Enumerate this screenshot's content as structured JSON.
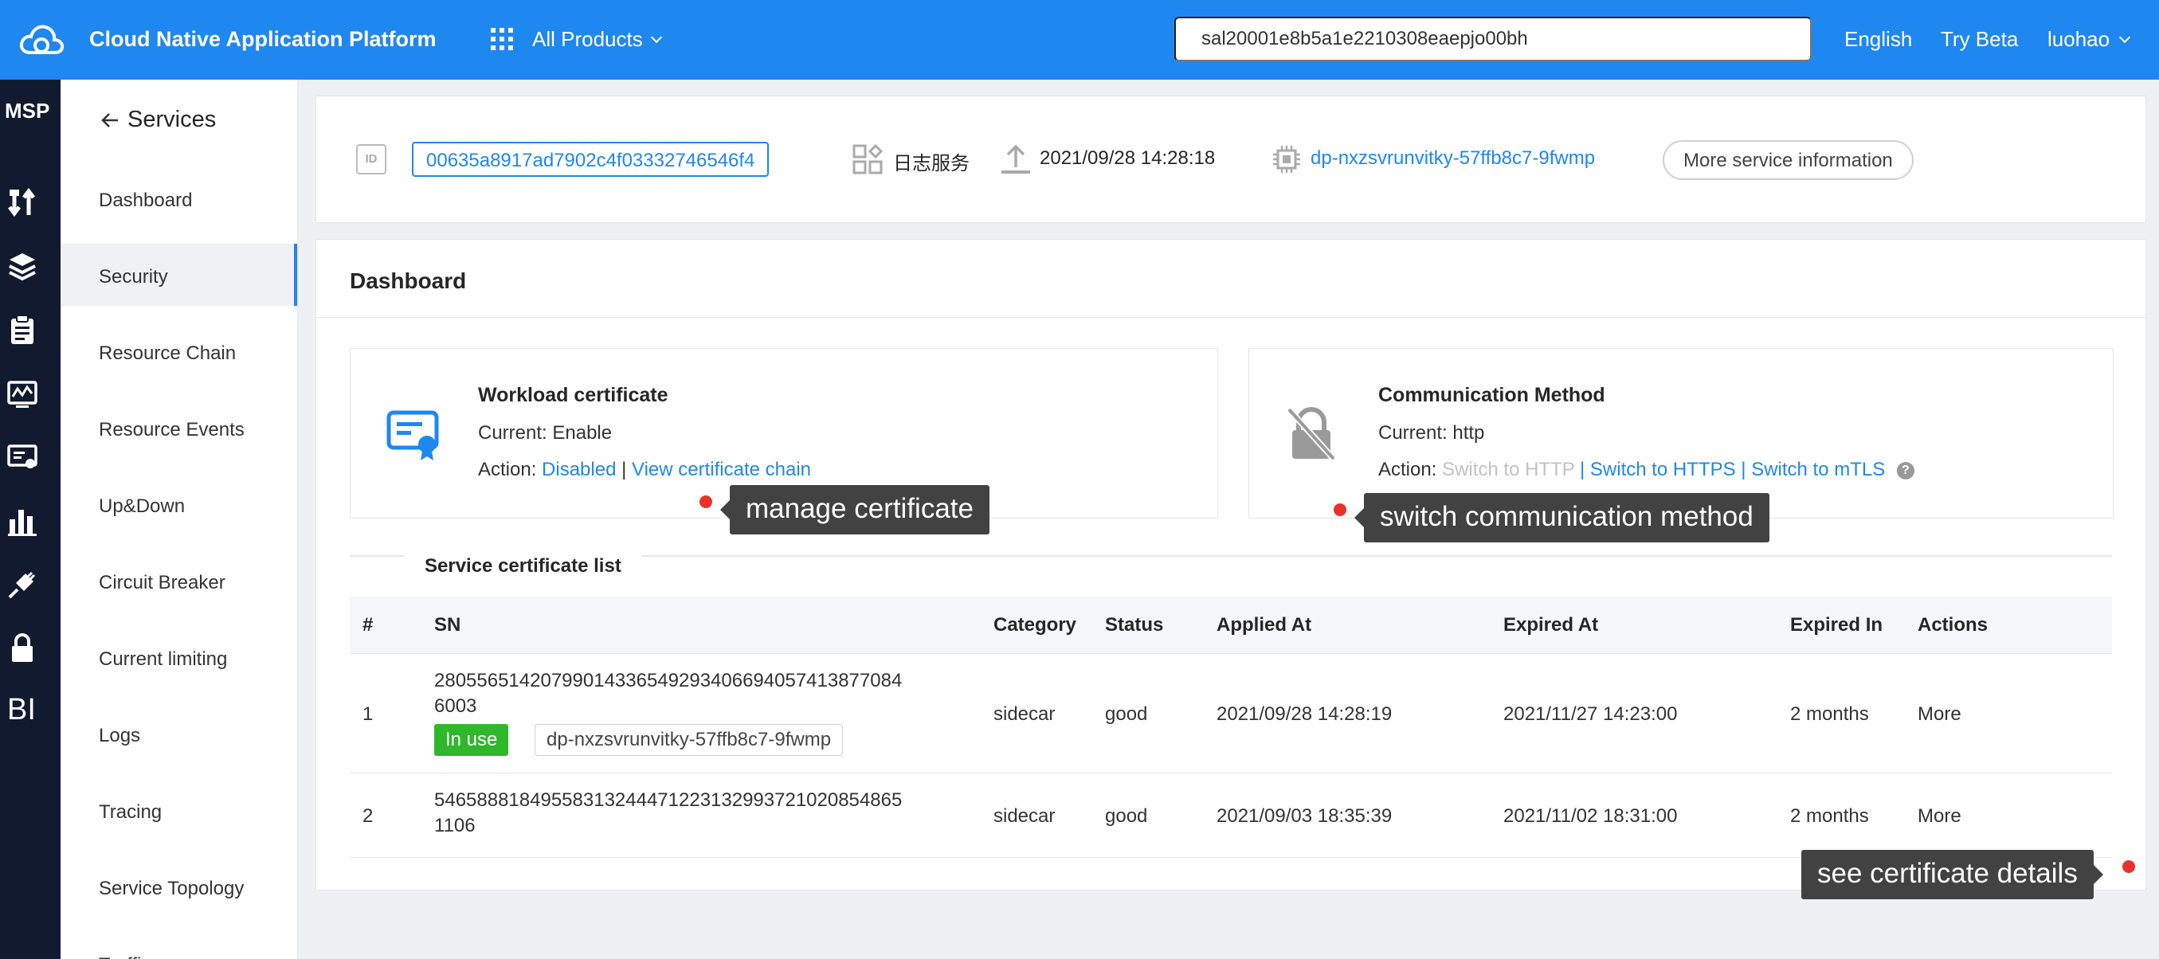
{
  "header": {
    "app_title": "Cloud Native Application Platform",
    "products_label": "All Products",
    "search_value": "sal20001e8b5a1e2210308eaepjo00bh",
    "language": "English",
    "try_beta": "Try Beta",
    "user": "luohao"
  },
  "rail": {
    "label": "MSP",
    "bi_label": "BI",
    "icons": [
      "transfer-icon",
      "layers-icon",
      "clipboard-icon",
      "monitor-chart-icon",
      "certificate-screen-icon",
      "bar-chart-icon",
      "plug-icon",
      "lock-icon"
    ]
  },
  "sidebar": {
    "back_label": "Services",
    "items": [
      {
        "label": "Dashboard"
      },
      {
        "label": "Security"
      },
      {
        "label": "Resource Chain"
      },
      {
        "label": "Resource Events"
      },
      {
        "label": "Up&Down"
      },
      {
        "label": "Circuit Breaker"
      },
      {
        "label": "Current limiting"
      },
      {
        "label": "Logs"
      },
      {
        "label": "Tracing"
      },
      {
        "label": "Service Topology"
      },
      {
        "label": "Traffic"
      }
    ]
  },
  "service_info": {
    "id_badge": "ID",
    "id_value": "00635a8917ad7902c4f03332746546f4",
    "service_name": "日志服务",
    "deployed_at": "2021/09/28 14:28:18",
    "pod_name": "dp-nxzsvrunvitky-57ffb8c7-9fwmp",
    "more_button": "More service information"
  },
  "dashboard": {
    "title": "Dashboard",
    "workload_card": {
      "title": "Workload certificate",
      "current": "Current: Enable",
      "action_prefix": "Action:",
      "action_disabled": "Disabled",
      "separator": "|",
      "action_view_chain": "View certificate chain"
    },
    "comm_card": {
      "title": "Communication Method",
      "current": "Current: http",
      "action_prefix": "Action:",
      "action_http": "Switch to HTTP",
      "action_https": "Switch to HTTPS",
      "action_mtls": "Switch to mTLS",
      "separator1": "|",
      "separator2": "|",
      "help": "?"
    },
    "cert_list_title": "Service certificate list",
    "table": {
      "headers": [
        "#",
        "SN",
        "Category",
        "Status",
        "Applied At",
        "Expired At",
        "Expired In",
        "Actions"
      ],
      "rows": [
        {
          "index": "1",
          "sn_line1": "28055651420799014336549293406694057413877084",
          "sn_line2": "6003",
          "tag_inuse": "In use",
          "tag_pod": "dp-nxzsvrunvitky-57ffb8c7-9fwmp",
          "category": "sidecar",
          "status": "good",
          "applied": "2021/09/28 14:28:19",
          "expired": "2021/11/27 14:23:00",
          "expired_in": "2 months",
          "action": "More"
        },
        {
          "index": "2",
          "sn_line1": "54658881849558313244471223132993721020854865",
          "sn_line2": "1106",
          "category": "sidecar",
          "status": "good",
          "applied": "2021/09/03 18:35:39",
          "expired": "2021/11/02 18:31:00",
          "expired_in": "2 months",
          "action": "More"
        }
      ]
    }
  },
  "annotations": {
    "manage_certificate": "manage certificate",
    "switch_comm": "switch communication method",
    "see_details": "see certificate details"
  }
}
